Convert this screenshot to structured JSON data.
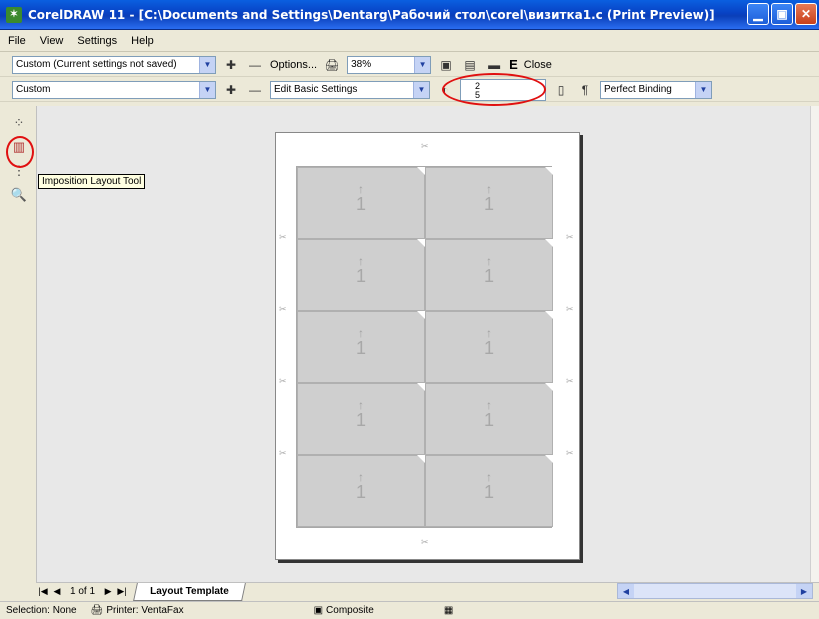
{
  "window": {
    "title": "CorelDRAW 11 - [C:\\Documents and Settings\\Dentarg\\Рабочий стол\\corel\\визитка1.c (Print Preview)]",
    "minimize": "▁",
    "maximize": "▣",
    "close": "✕"
  },
  "menu": [
    "File",
    "View",
    "Settings",
    "Help"
  ],
  "toolbar1": {
    "preset": "Custom (Current settings not saved)",
    "options_label": "Options...",
    "zoom": "38%",
    "close_label": "Close",
    "e_label": "E"
  },
  "toolbar2": {
    "preset": "Custom",
    "edit_settings": "Edit Basic Settings",
    "rows": "2",
    "cols": "5",
    "binding": "Perfect Binding"
  },
  "tooltip": "Imposition Layout Tool",
  "cell_number": "1",
  "cell_arrow": "↑",
  "nav": {
    "page_count": "1 of 1",
    "tab_label": "Layout Template"
  },
  "status": {
    "selection": "Selection: None",
    "printer": "Printer: VentaFax",
    "mode": "Composite"
  }
}
